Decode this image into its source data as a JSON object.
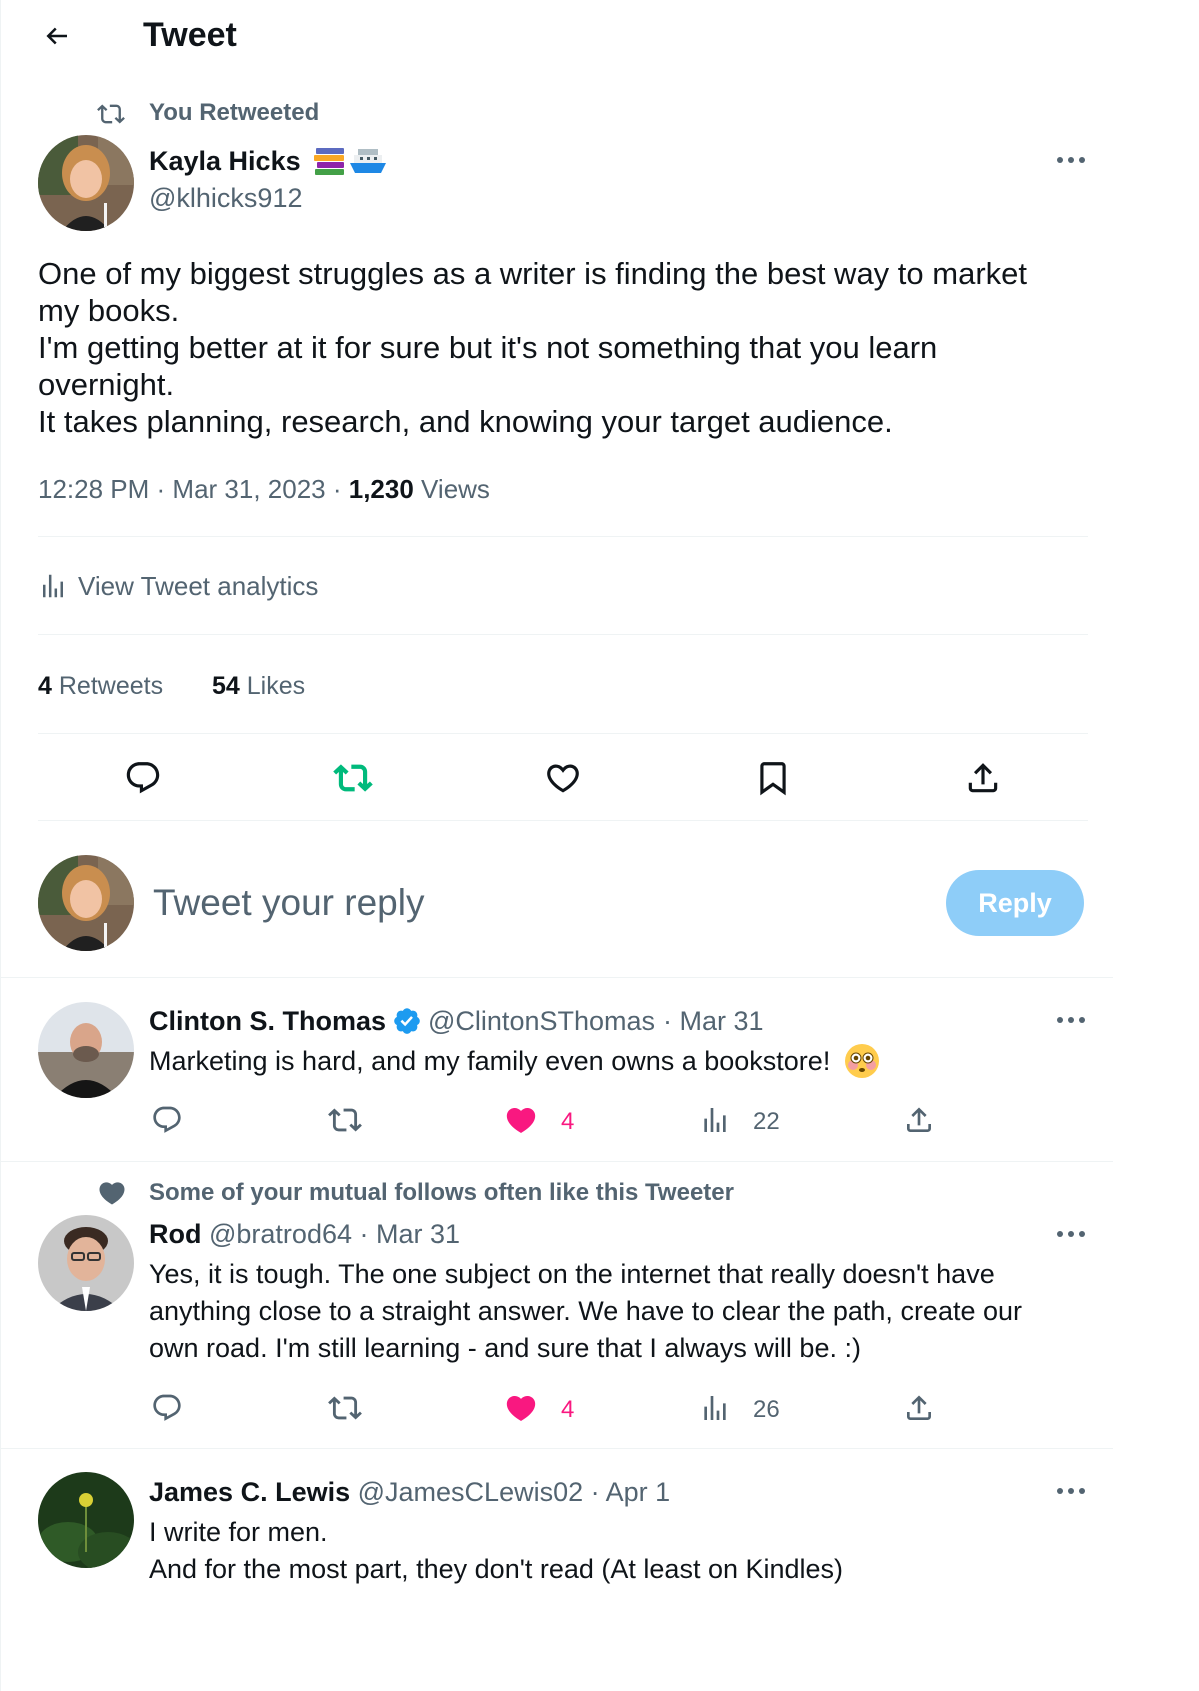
{
  "header": {
    "title": "Tweet"
  },
  "retweet_banner": "You Retweeted",
  "main_tweet": {
    "name": "Kayla Hicks",
    "handle": "@klhicks912",
    "text_lines": [
      "One of my biggest struggles as a writer is finding the best way to market",
      "my books.",
      "I'm getting better at it for sure but it's not something that you learn",
      "overnight.",
      "It takes planning, research, and knowing your target audience."
    ],
    "time": "12:28 PM",
    "date": "Mar 31, 2023",
    "views_count": "1,230",
    "views_label": "Views",
    "analytics_label": "View Tweet analytics",
    "retweets_count": "4",
    "retweets_label": "Retweets",
    "likes_count": "54",
    "likes_label": "Likes"
  },
  "composer": {
    "placeholder": "Tweet your reply",
    "reply_button": "Reply"
  },
  "replies": [
    {
      "name": "Clinton S. Thomas",
      "verified": true,
      "handle": "@ClintonSThomas",
      "date": "· Mar 31",
      "lines": [
        "Marketing is hard, and my family even owns a bookstore!"
      ],
      "likes": "4",
      "views": "22"
    },
    {
      "social_context": "Some of your mutual follows often like this Tweeter",
      "name": "Rod",
      "handle": "@bratrod64",
      "date": "· Mar 31",
      "lines": [
        "Yes, it is tough. The one subject on the internet that really doesn't have",
        "anything close to a straight answer. We have to clear the path, create our",
        "own road. I'm still learning - and sure that I always will be.  :)"
      ],
      "likes": "4",
      "views": "26"
    },
    {
      "name": "James C. Lewis",
      "handle": "@JamesCLewis02",
      "date": "· Apr 1",
      "lines": [
        "I write for men.",
        "And for the most part, they don't read (At least on Kindles)"
      ]
    }
  ],
  "colors": {
    "accent": "#1d9bf0",
    "retweet_green": "#00ba7c",
    "like_pink": "#f91880",
    "muted": "#536471"
  }
}
